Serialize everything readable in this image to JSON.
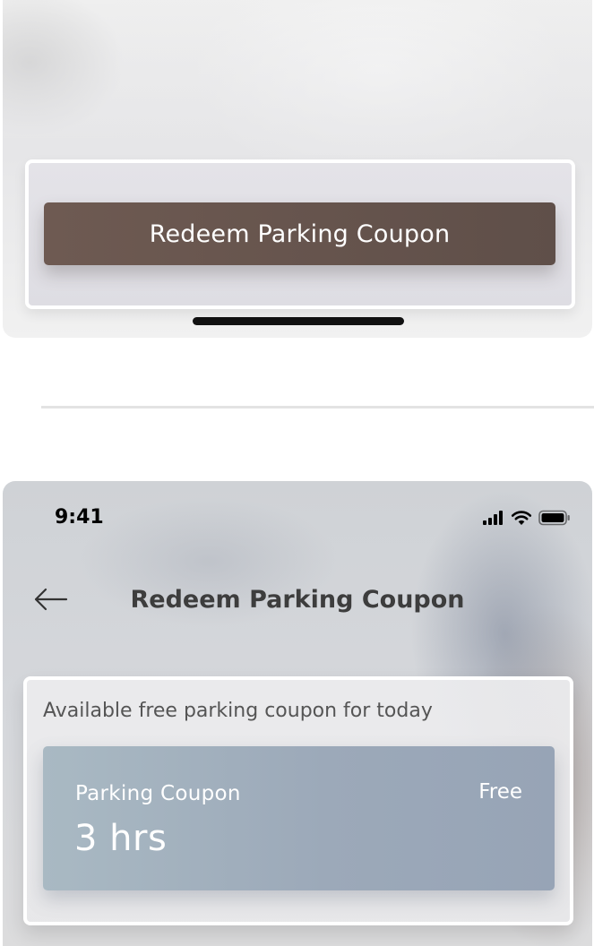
{
  "top_screen": {
    "redeem_button_label": "Redeem Parking Coupon"
  },
  "bottom_screen": {
    "status_bar": {
      "time": "9:41",
      "icons": [
        "cellular-signal-icon",
        "wifi-icon",
        "battery-icon"
      ]
    },
    "nav": {
      "back_icon": "arrow-left-icon",
      "title": "Redeem Parking Coupon"
    },
    "coupons": {
      "heading": "Available free parking coupon for today",
      "items": [
        {
          "name": "Parking Coupon",
          "duration": "3 hrs",
          "price": "Free"
        }
      ]
    }
  },
  "colors": {
    "button_brown": "#6e5a52",
    "coupon_card_blue": "#a3b2bf",
    "text_dark": "#3d3d3d",
    "white": "#ffffff"
  }
}
